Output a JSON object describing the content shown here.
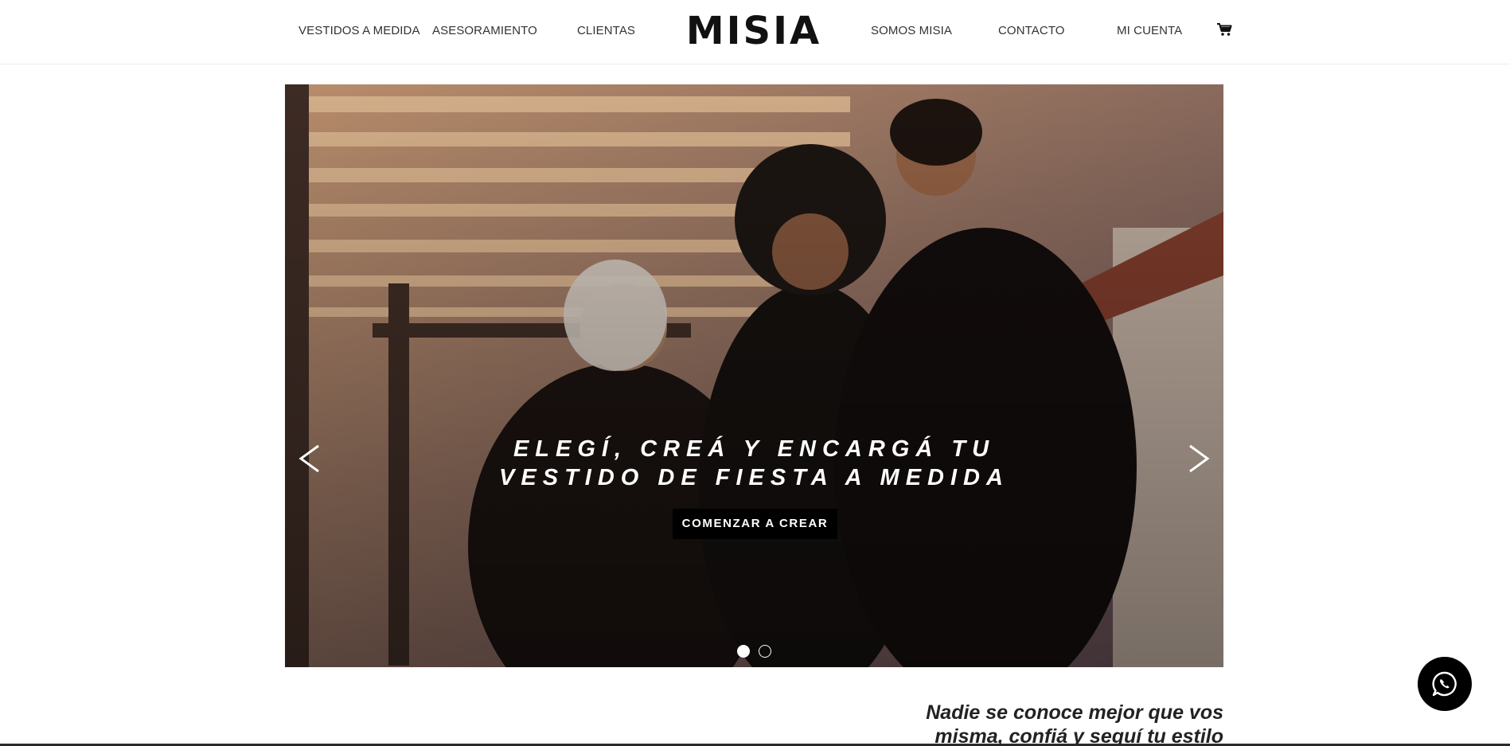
{
  "nav": {
    "items": [
      {
        "label": "VESTIDOS A MEDIDA"
      },
      {
        "label": "ASESORAMIENTO"
      },
      {
        "label": "CLIENTAS"
      },
      {
        "label": "SOMOS MISIA"
      },
      {
        "label": "CONTACTO"
      },
      {
        "label": "MI CUENTA"
      }
    ],
    "logo_text": "MISIA",
    "cart_icon": "cart-icon"
  },
  "hero": {
    "title_line1": "ELEGÍ, CREÁ Y ENCARGÁ TU",
    "title_line2": "VESTIDO DE FIESTA A MEDIDA",
    "cta_label": "COMENZAR A CREAR",
    "prev_icon": "chevron-left-icon",
    "next_icon": "chevron-right-icon",
    "slides_total": 2,
    "active_slide": 1
  },
  "tagline": {
    "line1": "Nadie se conoce mejor que vos",
    "line2": "misma, confiá y seguí tu estilo"
  },
  "whatsapp": {
    "icon": "whatsapp-icon"
  },
  "colors": {
    "accent": "#000000",
    "text": "#222222",
    "hero_tone": "#4a3024"
  }
}
